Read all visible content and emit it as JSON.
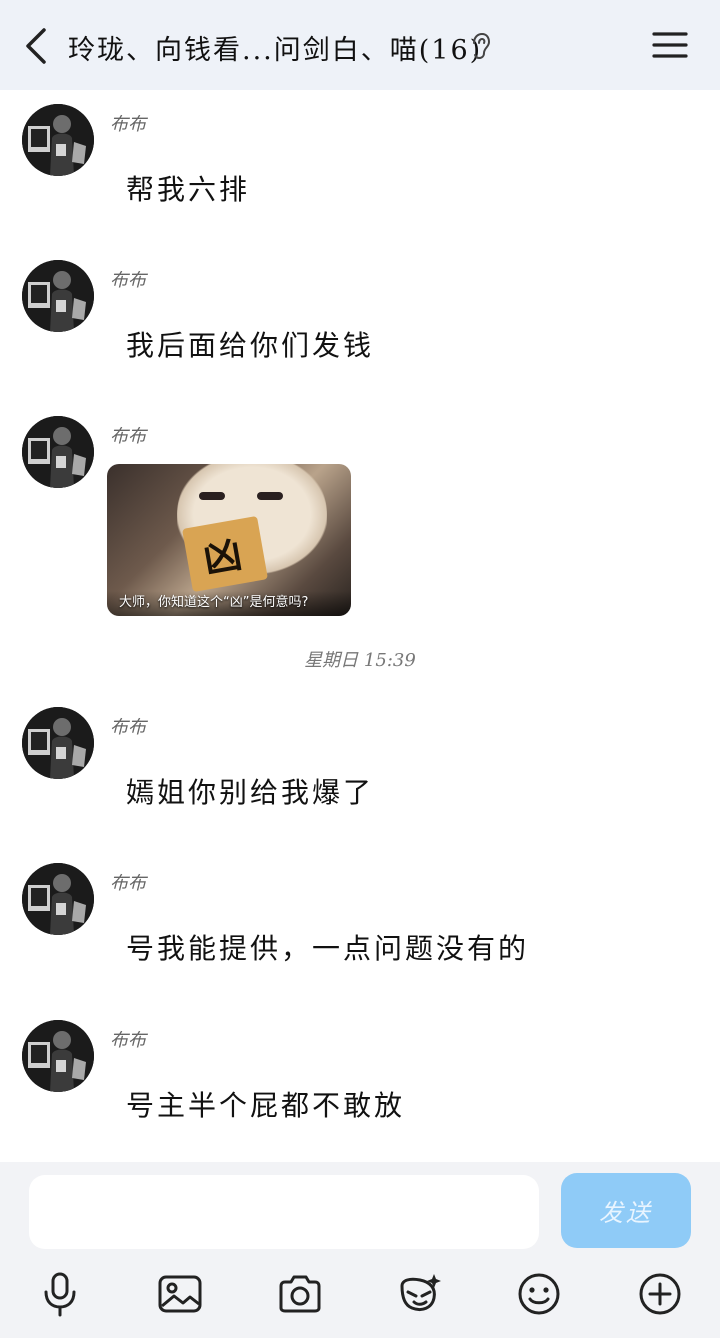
{
  "header": {
    "title": "玲珑、向钱看...问剑白、喵(16)",
    "back_icon": "chevron-left-icon",
    "ear_icon": "ear-icon",
    "menu_icon": "menu-icon"
  },
  "messages": [
    {
      "sender": "布布",
      "text": "帮我六排"
    },
    {
      "sender": "布布",
      "text": "我后面给你们发钱"
    },
    {
      "sender": "布布",
      "sticker_caption": "大师，你知道这个“凶”是何意吗?",
      "sticker_sign": "凶"
    },
    {
      "sender": "布布",
      "text": "嫣姐你别给我爆了"
    },
    {
      "sender": "布布",
      "text": "号我能提供，一点问题没有的"
    },
    {
      "sender": "布布",
      "text": "号主半个屁都不敢放"
    }
  ],
  "timestamp": "星期日 15:39",
  "composer": {
    "input_value": "",
    "send_label": "发送"
  },
  "toolbar": {
    "icons": [
      "microphone-icon",
      "image-icon",
      "camera-icon",
      "sticker-icon",
      "emoji-icon",
      "plus-icon"
    ]
  },
  "colors": {
    "header_bg": "#eef2f8",
    "send_button": "#8fcbf7",
    "composer_bg": "#f2f3f6"
  }
}
